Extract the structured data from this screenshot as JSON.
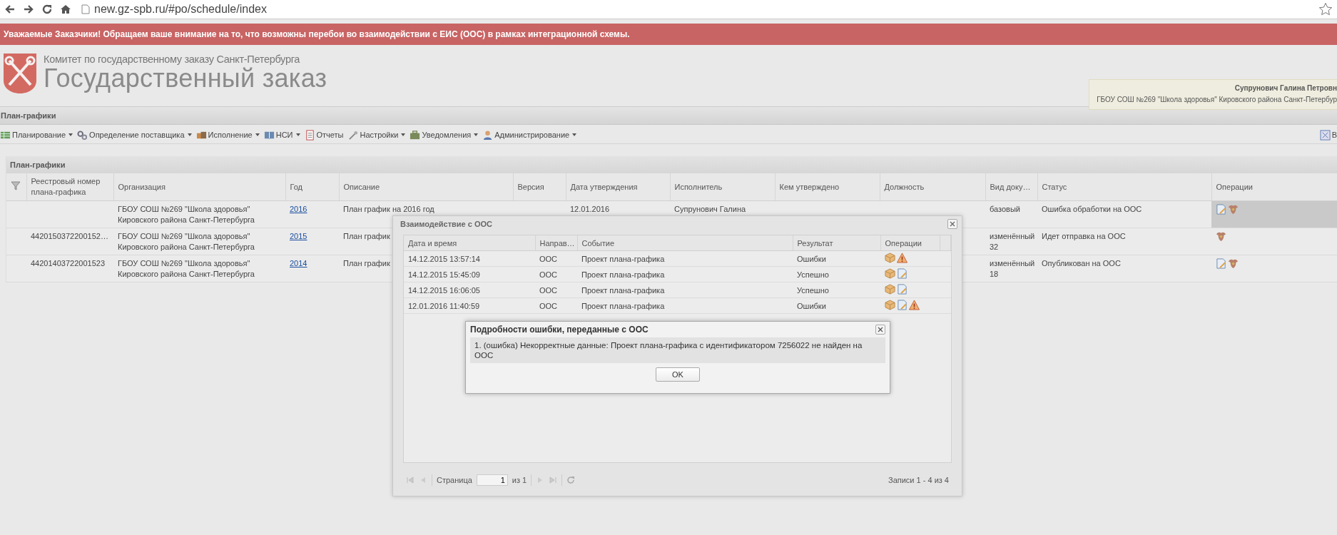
{
  "browser": {
    "url": "new.gz-spb.ru/#po/schedule/index"
  },
  "banner": "Уважаемые Заказчики! Обращаем ваше внимание на то, что возможны перебои во взаимодействии с ЕИС (ООС) в рамках интеграционной схемы.",
  "header": {
    "subtitle": "Комитет по государственному заказу Санкт-Петербурга",
    "title": "Государственный заказ",
    "user": {
      "name": "Супрунович Галина Петровн",
      "org": "ГБОУ СОШ №269 \"Школа здоровья\" Кировского района Санкт-Петербур"
    }
  },
  "section_title": "План-графики",
  "menu": [
    {
      "label": "Планирование",
      "dropdown": true
    },
    {
      "label": "Определение поставщика",
      "dropdown": true
    },
    {
      "label": "Исполнение",
      "dropdown": true
    },
    {
      "label": "НСИ",
      "dropdown": true
    },
    {
      "label": "Отчеты",
      "dropdown": false
    },
    {
      "label": "Настройки",
      "dropdown": true
    },
    {
      "label": "Уведомления",
      "dropdown": true
    },
    {
      "label": "Администрирование",
      "dropdown": true
    }
  ],
  "menu_right": {
    "label": "В"
  },
  "panel": {
    "title": "План-графики",
    "columns": [
      "Реестровый номер плана-графика",
      "Организация",
      "Год",
      "Описание",
      "Версия",
      "Дата утверждения",
      "Исполнитель",
      "Кем утверждено",
      "Должность",
      "Вид доку…",
      "Статус",
      "Операции"
    ],
    "rows": [
      {
        "organization": "ГБОУ СОШ №269 \"Школа здоровья\"\nКировского района Санкт-Петербурга",
        "year": "2016",
        "description": "План график на 2016 год",
        "approval_date": "12.01.2016",
        "executor": "Супрунович Галина",
        "doc_type": "базовый",
        "status": "Ошибка обработки на ООС",
        "highlighted": true,
        "operations": [
          {
            "kind": "edit"
          },
          {
            "kind": "emblem"
          }
        ]
      },
      {
        "registry_number": "4420150372200152…",
        "organization": "ГБОУ СОШ №269 \"Школа здоровья\"\nКировского района Санкт-Петербурга",
        "year": "2015",
        "description": "План график",
        "doc_type": "изменённый\n32",
        "status": "Идет отправка на ООС",
        "highlighted": false,
        "operations": [
          {
            "kind": "emblem"
          }
        ]
      },
      {
        "registry_number": "44201403722001523",
        "organization": "ГБОУ СОШ №269 \"Школа здоровья\"\nКировского района Санкт-Петербурга",
        "year": "2014",
        "description": "План график",
        "doc_type": "изменённый\n18",
        "status": "Опубликован на ООС",
        "highlighted": false,
        "operations": [
          {
            "kind": "edit"
          },
          {
            "kind": "emblem"
          }
        ]
      }
    ]
  },
  "dialog": {
    "title": "Взаимодействие с ООС",
    "columns": [
      "Дата и время",
      "Направ…",
      "Событие",
      "Результат",
      "Операции"
    ],
    "rows": [
      {
        "datetime": "14.12.2015 13:57:14",
        "direction": "ООС",
        "event": "Проект плана-графика",
        "result": "Ошибки",
        "operations": [
          {
            "kind": "package"
          },
          {
            "kind": "warning"
          }
        ]
      },
      {
        "datetime": "14.12.2015 15:45:09",
        "direction": "ООС",
        "event": "Проект плана-графика",
        "result": "Успешно",
        "operations": [
          {
            "kind": "package"
          },
          {
            "kind": "edit"
          }
        ]
      },
      {
        "datetime": "14.12.2015 16:06:05",
        "direction": "ООС",
        "event": "Проект плана-графика",
        "result": "Успешно",
        "operations": [
          {
            "kind": "package"
          },
          {
            "kind": "edit"
          }
        ]
      },
      {
        "datetime": "12.01.2016 11:40:59",
        "direction": "ООС",
        "event": "Проект плана-графика",
        "result": "Ошибки",
        "operations": [
          {
            "kind": "package"
          },
          {
            "kind": "edit"
          },
          {
            "kind": "warning"
          }
        ]
      }
    ],
    "pager": {
      "page_label": "Страница",
      "page": "1",
      "of": "из 1",
      "records": "Записи 1 - 4 из 4"
    }
  },
  "error_dialog": {
    "title": "Подробности ошибки, переданные с ООС",
    "message": "1. (ошибка) Некорректные данные: Проект плана-графика с идентификатором 7256022 не найден на ООС",
    "button": "OK"
  }
}
